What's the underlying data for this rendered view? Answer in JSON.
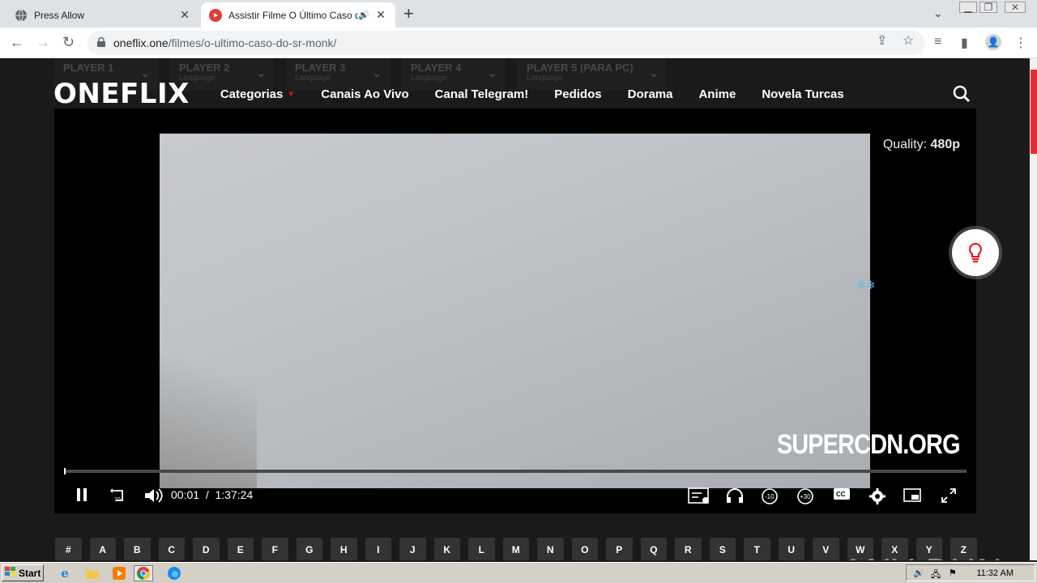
{
  "browser": {
    "tabs": [
      {
        "title": "Press Allow",
        "active": false
      },
      {
        "title": "Assistir Filme O Último Caso do S",
        "active": true
      }
    ],
    "url_host": "oneflix.one",
    "url_path": "/filmes/o-ultimo-caso-do-sr-monk/"
  },
  "site": {
    "logo": "ONEFLIX",
    "players": [
      {
        "label": "PLAYER 1",
        "sub": ""
      },
      {
        "label": "PLAYER 2",
        "sub": "Language"
      },
      {
        "label": "PLAYER 3",
        "sub": "Language"
      },
      {
        "label": "PLAYER 4",
        "sub": "Language"
      },
      {
        "label": "PLAYER 5 (PARA PC)",
        "sub": "Language"
      }
    ],
    "nav": [
      "Categorias",
      "Canais Ao Vivo",
      "Canal Telegram!",
      "Pedidos",
      "Dorama",
      "Anime",
      "Novela Turcas"
    ]
  },
  "player": {
    "quality_label": "Quality:",
    "quality_value": "480p",
    "brand": "SUPERCDN.ORG",
    "current_time": "00:01",
    "separator": "/",
    "duration": "1:37:24",
    "progress": 0.001
  },
  "letters": [
    "#",
    "A",
    "B",
    "C",
    "D",
    "E",
    "F",
    "G",
    "H",
    "I",
    "J",
    "K",
    "L",
    "M",
    "N",
    "O",
    "P",
    "Q",
    "R",
    "S",
    "T",
    "U",
    "V",
    "W",
    "X",
    "Y",
    "Z"
  ],
  "watermark": "ANY RUN",
  "taskbar": {
    "start_label": "Start",
    "clock": "11:32 AM"
  },
  "colors": {
    "accent": "#e50914",
    "page_bg": "#1a1a1a"
  }
}
